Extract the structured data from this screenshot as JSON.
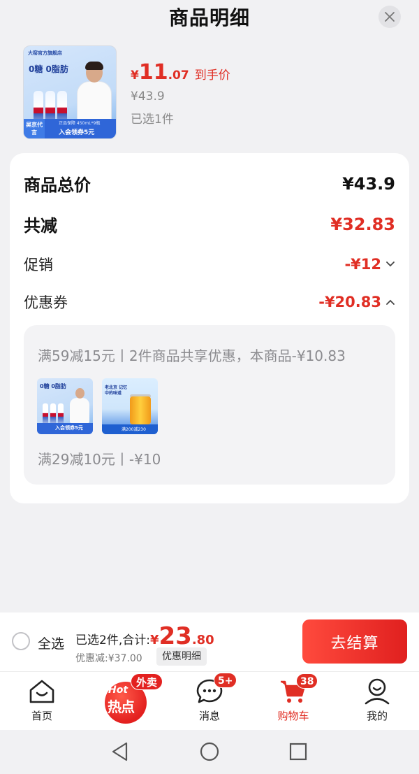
{
  "header": {
    "title": "商品明细",
    "close_icon": "close-icon"
  },
  "product": {
    "image_brand_line": "大窑官方旗舰店",
    "image_slogan": "0糖 0脂肪",
    "image_badge_left": "吴京代言",
    "image_badge_spec": "正品保障 450mL*9瓶",
    "image_badge_right": "入会领券5元",
    "price_yen": "¥",
    "price_int": "11",
    "price_dec": ".07",
    "price_tag": "到手价",
    "original_price": "¥43.9",
    "selected": "已选1件"
  },
  "summary": {
    "total_label": "商品总价",
    "total_value": "¥43.9",
    "reduce_label": "共减",
    "reduce_value": "¥32.83",
    "promo_label": "促销",
    "promo_value": "-¥12",
    "coupon_label": "优惠券",
    "coupon_value": "-¥20.83",
    "coupon_detail_1": "满59减15元丨2件商品共享优惠，本商品-¥10.83",
    "coupon_detail_2": "满29减10元丨-¥10",
    "thumb_a_slogan": "0糖 0脂肪",
    "thumb_a_badge": "入会领券5元",
    "thumb_b_text": "老北京 记忆中的味道",
    "thumb_b_badge": "满200减230"
  },
  "checkout": {
    "select_all": "全选",
    "sum_label": "已选2件,合计:",
    "sum_yen": "¥",
    "sum_int": "23",
    "sum_dec": ".80",
    "discount": "优惠减:¥37.00",
    "detail_button": "优惠明细",
    "pay_button": "去结算"
  },
  "tabs": {
    "home": "首页",
    "hot_en": "Hot",
    "hot_cn": "热点",
    "hot_badge": "外卖",
    "messages": "消息",
    "messages_badge": "5+",
    "cart": "购物车",
    "cart_badge": "38",
    "me": "我的"
  },
  "colors": {
    "accent": "#e02e24",
    "background": "#f1f1f3"
  }
}
